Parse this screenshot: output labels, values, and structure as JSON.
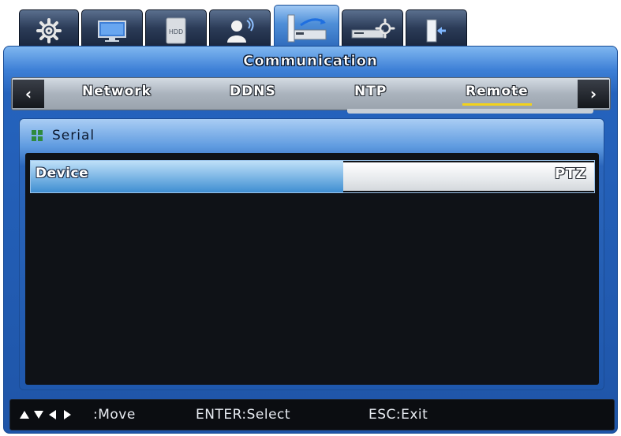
{
  "top_tabs": [
    {
      "id": "system",
      "icon": "gear-icon",
      "active": false
    },
    {
      "id": "display",
      "icon": "monitor-icon",
      "active": false
    },
    {
      "id": "hdd",
      "icon": "hdd-icon",
      "label": "HDD",
      "active": false
    },
    {
      "id": "user",
      "icon": "user-icon",
      "active": false
    },
    {
      "id": "communication",
      "icon": "network-device-icon",
      "active": true
    },
    {
      "id": "record",
      "icon": "recorder-settings-icon",
      "active": false
    },
    {
      "id": "exit",
      "icon": "exit-door-icon",
      "active": false
    }
  ],
  "panel": {
    "title": "Communication"
  },
  "sub_tabs": {
    "left_arrow": "‹",
    "right_arrow": "›",
    "items": [
      {
        "label": "Network"
      },
      {
        "label": "DDNS"
      },
      {
        "label": "NTP"
      },
      {
        "label": "Remote",
        "active": true
      }
    ]
  },
  "section": {
    "title": "Serial"
  },
  "rows": [
    {
      "label": "Device",
      "value": "PTZ"
    }
  ],
  "footer": {
    "move": ":Move",
    "select": "ENTER:Select",
    "exit": "ESC:Exit"
  },
  "colors": {
    "panel_blue": "#2563bd",
    "active_underline": "#f2d21a",
    "content_bg": "#0f1217"
  }
}
